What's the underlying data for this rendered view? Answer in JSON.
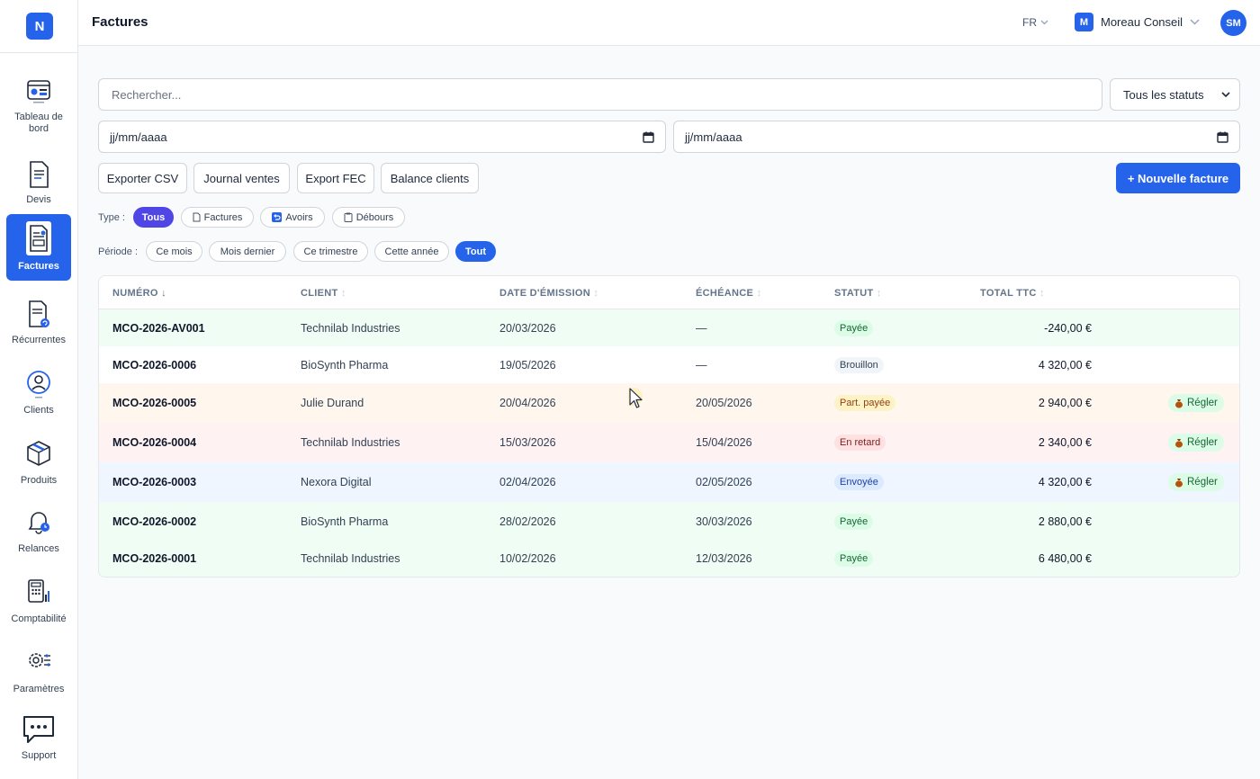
{
  "app": {
    "logo": "N",
    "page_title": "Factures"
  },
  "header": {
    "lang": "FR",
    "org_badge": "M",
    "org_name": "Moreau Conseil",
    "avatar": "SM"
  },
  "sidebar": {
    "items": [
      {
        "label": "Tableau de bord",
        "icon": "dashboard-icon",
        "active": false
      },
      {
        "label": "Devis",
        "icon": "quote-document-icon",
        "active": false
      },
      {
        "label": "Factures",
        "icon": "invoice-icon",
        "active": true
      },
      {
        "label": "Récurrentes",
        "icon": "recurring-invoice-icon",
        "active": false
      },
      {
        "label": "Clients",
        "icon": "client-icon",
        "active": false
      },
      {
        "label": "Produits",
        "icon": "product-box-icon",
        "active": false
      },
      {
        "label": "Relances",
        "icon": "bell-icon",
        "active": false
      },
      {
        "label": "Comptabilité",
        "icon": "calculator-icon",
        "active": false
      },
      {
        "label": "Paramètres",
        "icon": "settings-gear-icon",
        "active": false
      },
      {
        "label": "Support",
        "icon": "chat-bubble-icon",
        "active": false
      }
    ]
  },
  "filters": {
    "search_placeholder": "Rechercher...",
    "status_select": "Tous les statuts",
    "date_from": "jj/mm/aaaa",
    "date_to": "jj/mm/aaaa"
  },
  "actions": {
    "export_csv": "Exporter CSV",
    "journal_ventes": "Journal ventes",
    "export_fec": "Export FEC",
    "balance_clients": "Balance clients",
    "new_invoice": "+ Nouvelle facture"
  },
  "type_filter": {
    "label": "Type :",
    "chips": [
      "Tous",
      "Factures",
      "Avoirs",
      "Débours"
    ],
    "active": "Tous"
  },
  "period_filter": {
    "label": "Période :",
    "chips": [
      "Ce mois",
      "Mois dernier",
      "Ce trimestre",
      "Cette année",
      "Tout"
    ],
    "active": "Tout"
  },
  "table": {
    "columns": {
      "numero": "NUMÉRO",
      "client": "CLIENT",
      "date": "DATE D'ÉMISSION",
      "echeance": "ÉCHÉANCE",
      "statut": "STATUT",
      "total": "TOTAL TTC"
    },
    "sort_desc": "↓",
    "sort_none": "↕",
    "settle_label": "Régler",
    "rows": [
      {
        "numero": "MCO-2026-AV001",
        "client": "Technilab Industries",
        "date": "20/03/2026",
        "echeance": "—",
        "statut": "Payée",
        "total": "-240,00 €",
        "regler": false
      },
      {
        "numero": "MCO-2026-0006",
        "client": "BioSynth Pharma",
        "date": "19/05/2026",
        "echeance": "—",
        "statut": "Brouillon",
        "total": "4 320,00 €",
        "regler": false
      },
      {
        "numero": "MCO-2026-0005",
        "client": "Julie Durand",
        "date": "20/04/2026",
        "echeance": "20/05/2026",
        "statut": "Part. payée",
        "total": "2 940,00 €",
        "regler": true
      },
      {
        "numero": "MCO-2026-0004",
        "client": "Technilab Industries",
        "date": "15/03/2026",
        "echeance": "15/04/2026",
        "statut": "En retard",
        "total": "2 340,00 €",
        "regler": true
      },
      {
        "numero": "MCO-2026-0003",
        "client": "Nexora Digital",
        "date": "02/04/2026",
        "echeance": "02/05/2026",
        "statut": "Envoyée",
        "total": "4 320,00 €",
        "regler": true
      },
      {
        "numero": "MCO-2026-0002",
        "client": "BioSynth Pharma",
        "date": "28/02/2026",
        "echeance": "30/03/2026",
        "statut": "Payée",
        "total": "2 880,00 €",
        "regler": false
      },
      {
        "numero": "MCO-2026-0001",
        "client": "Technilab Industries",
        "date": "10/02/2026",
        "echeance": "12/03/2026",
        "statut": "Payée",
        "total": "6 480,00 €",
        "regler": false
      }
    ]
  },
  "colors": {
    "primary": "#2563eb",
    "indigo": "#4f46e5",
    "row_paid": "#f0fdf4",
    "row_partial": "#fff7ed",
    "row_late": "#fef2f2",
    "row_sent": "#eff6ff"
  }
}
